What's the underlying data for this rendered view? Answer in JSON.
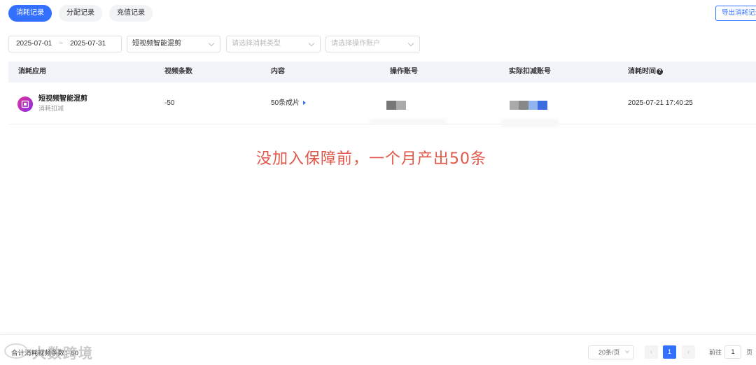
{
  "tabs": [
    {
      "label": "消耗记录",
      "active": true
    },
    {
      "label": "分配记录",
      "active": false
    },
    {
      "label": "充值记录",
      "active": false
    }
  ],
  "export_label": "导出消耗记录",
  "filters": {
    "date_start": "2025-07-01",
    "date_sep": "~",
    "date_end": "2025-07-31",
    "app_select": "短视频智能混剪",
    "type_placeholder": "请选择消耗类型",
    "account_placeholder": "请选择操作账户"
  },
  "table": {
    "headers": [
      "消耗应用",
      "视频条数",
      "内容",
      "操作账号",
      "实际扣减账号",
      "消耗时间"
    ],
    "help_glyph": "?",
    "rows": [
      {
        "app_name": "短视频智能混剪",
        "app_sub": "消耗扣减",
        "count": "-50",
        "content": "50条成片",
        "time": "2025-07-21 17:40:25"
      }
    ]
  },
  "annotation": "没加入保障前，一个月产出50条",
  "footer": {
    "total_label": "合计消耗视频条数：",
    "total_value": "50",
    "watermark": "大数跨境",
    "page_size": "20条/页",
    "prev": "‹",
    "current_page": "1",
    "next": "›",
    "goto_label": "前往",
    "goto_value": "1",
    "page_unit": "页"
  },
  "colors": {
    "accent": "#3370ff",
    "annotation": "#e0584a"
  }
}
